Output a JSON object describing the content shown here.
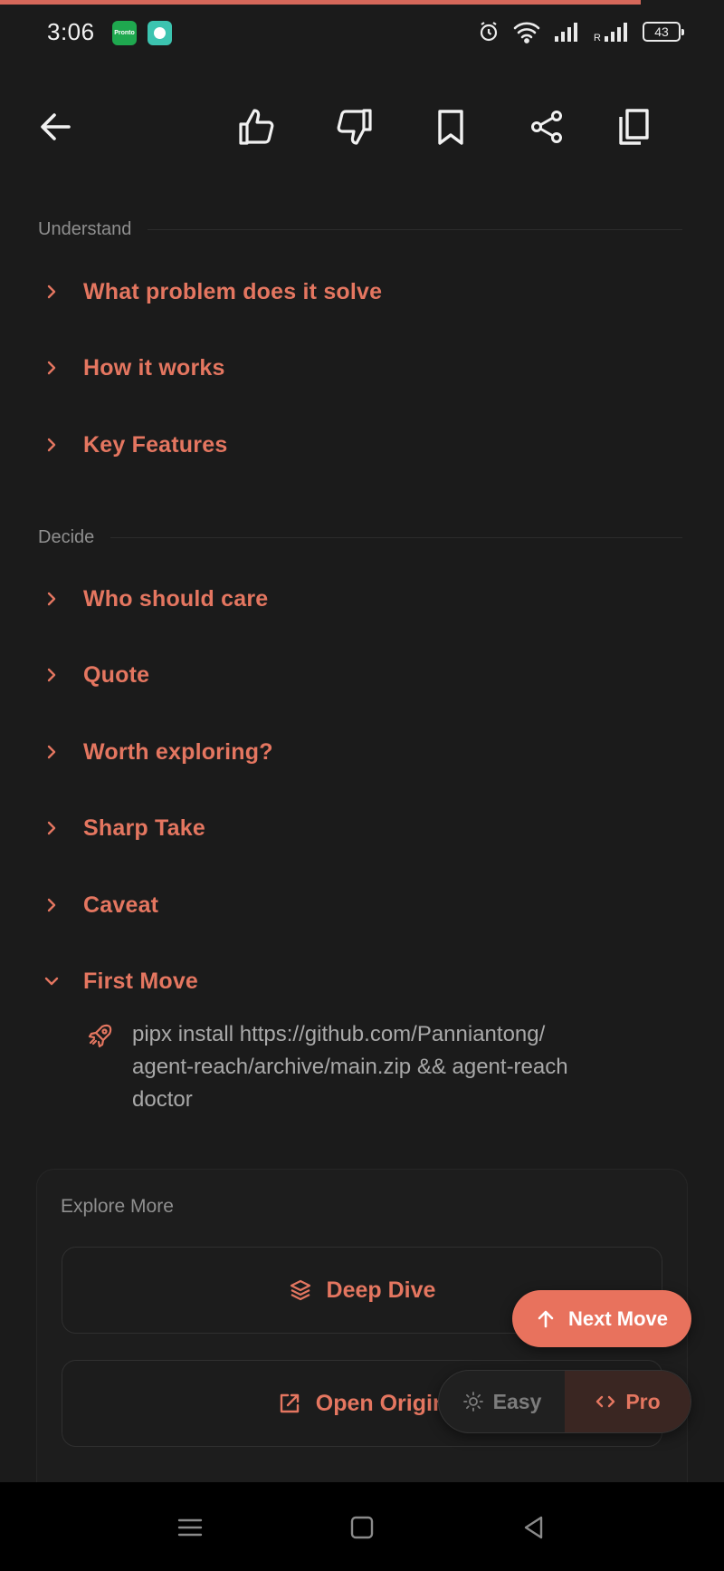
{
  "status_bar": {
    "time": "3:06",
    "app1_label": "Pronto",
    "battery": "43"
  },
  "toolbar": {
    "back": "arrow-left-icon",
    "like": "thumbs-up-icon",
    "dislike": "thumbs-down-icon",
    "bookmark": "bookmark-icon",
    "share": "share-icon",
    "copy": "copy-icon"
  },
  "sections": {
    "understand": {
      "label": "Understand",
      "items": [
        {
          "title": "What problem does it solve",
          "expanded": false
        },
        {
          "title": "How it works",
          "expanded": false
        },
        {
          "title": "Key Features",
          "expanded": false
        }
      ]
    },
    "decide": {
      "label": "Decide",
      "items": [
        {
          "title": "Who should care",
          "expanded": false
        },
        {
          "title": "Quote",
          "expanded": false
        },
        {
          "title": "Worth exploring?",
          "expanded": false
        },
        {
          "title": "Sharp Take",
          "expanded": false
        },
        {
          "title": "Caveat",
          "expanded": false
        },
        {
          "title": "First Move",
          "expanded": true
        }
      ]
    }
  },
  "first_move": {
    "line1": "pipx install https://github.com/Panniantong/",
    "line2": "agent-reach/archive/main.zip && agent-reach",
    "line3": "doctor"
  },
  "explore": {
    "title": "Explore More",
    "deep_dive": "Deep Dive",
    "open_original": "Open Origin"
  },
  "floating": {
    "next_move": "Next Move",
    "easy": "Easy",
    "pro": "Pro",
    "active_mode": "Pro"
  },
  "colors": {
    "accent": "#e47660",
    "background": "#1b1b1b",
    "muted": "#8f8f8f"
  }
}
